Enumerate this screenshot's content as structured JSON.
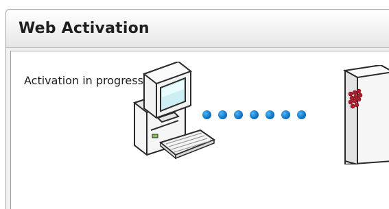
{
  "dialog": {
    "title": "Web Activation",
    "status_text": "Activation in progress..."
  },
  "illustration": {
    "left_icon": "computer-icon",
    "right_icon": "server-icon",
    "dot_count": 7,
    "dot_color": "#1477c9"
  }
}
